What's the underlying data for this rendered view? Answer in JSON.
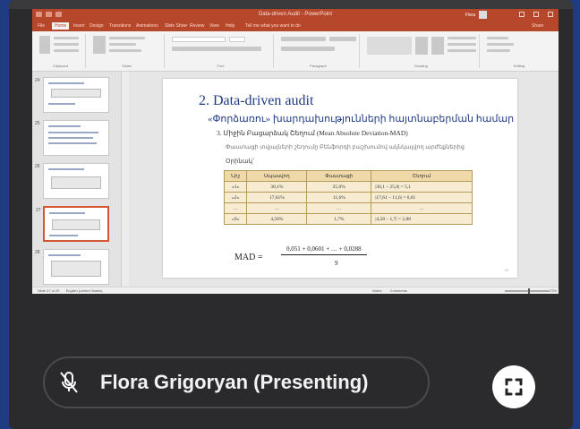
{
  "powerpoint": {
    "window_title": "Data-driven Audit - PowerPoint",
    "user": "Flora",
    "tabs": [
      "File",
      "Home",
      "Insert",
      "Design",
      "Transitions",
      "Animations",
      "Slide Show",
      "Review",
      "View",
      "Help",
      "Tell me what you want to do",
      "Share"
    ],
    "active_tab": "Home",
    "ribbon_groups": [
      "Clipboard",
      "Slides",
      "Font",
      "Paragraph",
      "Drawing",
      "Editing"
    ],
    "thumbnail_numbers": [
      "24",
      "25",
      "26",
      "27",
      "28"
    ],
    "status_text": "Slide 27 of 29",
    "status_language": "English (United States)",
    "notes_label": "Notes",
    "comments_label": "Comments",
    "zoom_level": "73%"
  },
  "slide": {
    "title": "2. Data-driven audit",
    "subtitle": "«Փորձառու» խարդախությունների հայտնաբերման համար",
    "heading": "3. Միջին Բացարձակ Շեղում (Mean Absolute Deviation-MAD)",
    "paragraph": "Փաստացի տվյալների շեղումը Բենֆորդի բաշխումով ակնկալվող արժեքներից",
    "example_label": "Օրինակ՝",
    "table": {
      "headers": [
        "Նիշ",
        "Սպասվող",
        "Փաստացի",
        "Շեղում"
      ],
      "rows": [
        [
          "«1»",
          "30,1%",
          "25,0%",
          "|30,1 – 25,0| = 5,1"
        ],
        [
          "«2»",
          "17,61%",
          "11,6%",
          "|17,61 – 11,6| = 6,01"
        ],
        [
          "…",
          "…",
          "…",
          "…"
        ],
        [
          "«9»",
          "4,58%",
          "1,7%",
          "|4,58 – 1,7| = 2,88"
        ]
      ]
    },
    "formula": {
      "lhs": "MAD =",
      "numerator": "0,051 + 0,0601 + … + 0,0288",
      "denominator": "9"
    },
    "page_number": "26"
  },
  "presenter": {
    "name_label": "Flora Grigoryan (Presenting)",
    "mic_icon": "mic-muted-icon",
    "fullscreen_icon": "fullscreen-icon"
  }
}
